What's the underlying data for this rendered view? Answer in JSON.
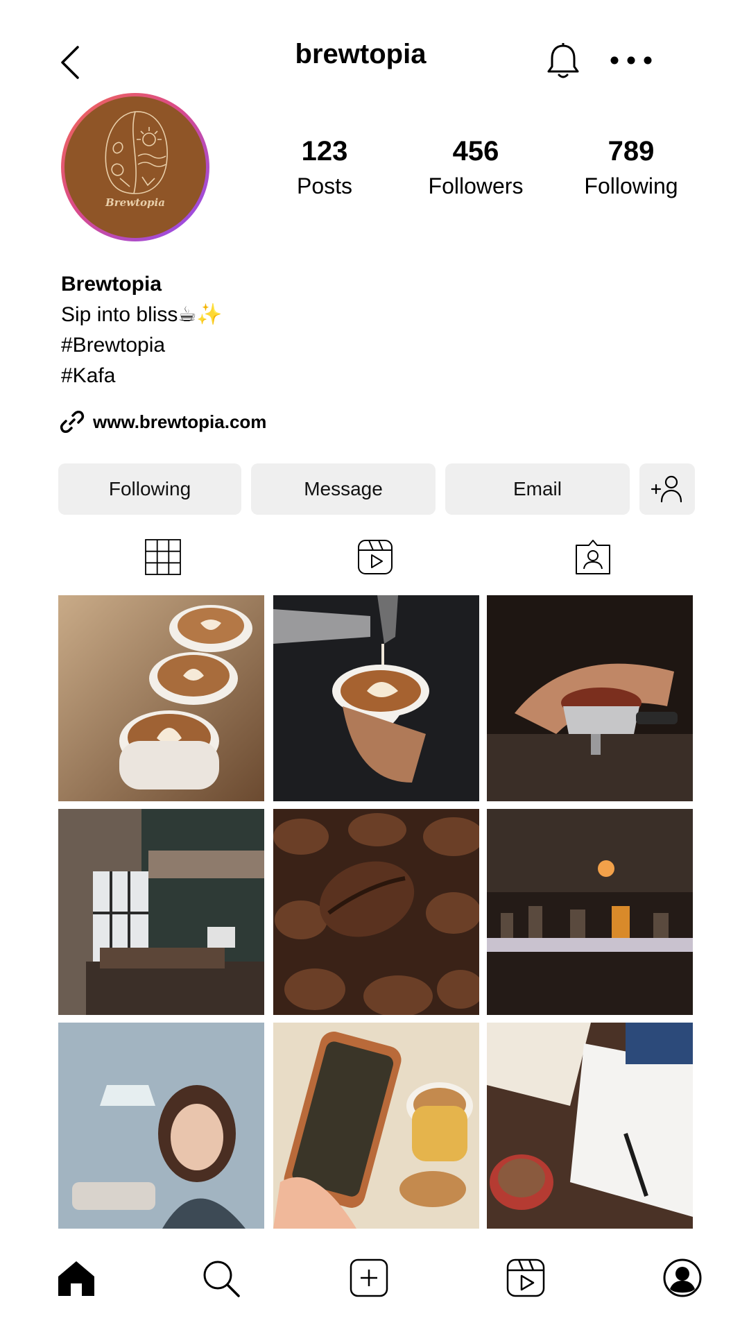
{
  "header": {
    "username": "brewtopia",
    "icons": {
      "back": "chevron-left-icon",
      "notifications": "bell-icon",
      "more": "more-horizontal-icon"
    }
  },
  "profile": {
    "avatar_text": "Brewtopia",
    "avatar_color": "#8f5527",
    "stats": [
      {
        "value": "123",
        "label": "Posts"
      },
      {
        "value": "456",
        "label": "Followers"
      },
      {
        "value": "789",
        "label": "Following"
      }
    ],
    "display_name": "Brewtopia",
    "bio_lines": [
      "Sip into bliss☕✨",
      "#Brewtopia",
      "#Kafa"
    ],
    "website": "www.brewtopia.com"
  },
  "actions": {
    "following": "Following",
    "message": "Message",
    "email": "Email",
    "add_user_icon": "add-person-icon"
  },
  "tabs": [
    "grid-icon",
    "reels-icon",
    "tagged-icon"
  ],
  "posts": [
    "three latte art cups on wooden table",
    "pouring latte art into cup",
    "portafilter with ground coffee",
    "coffee shop interior",
    "roasted coffee beans close-up",
    "dark cafe bar with lamps",
    "woman sitting in cafe by window",
    "phone photographing coffee",
    "notebook and red coffee cup"
  ],
  "bottom_nav": [
    "home-icon",
    "search-icon",
    "create-icon",
    "reels-icon",
    "profile-icon"
  ]
}
